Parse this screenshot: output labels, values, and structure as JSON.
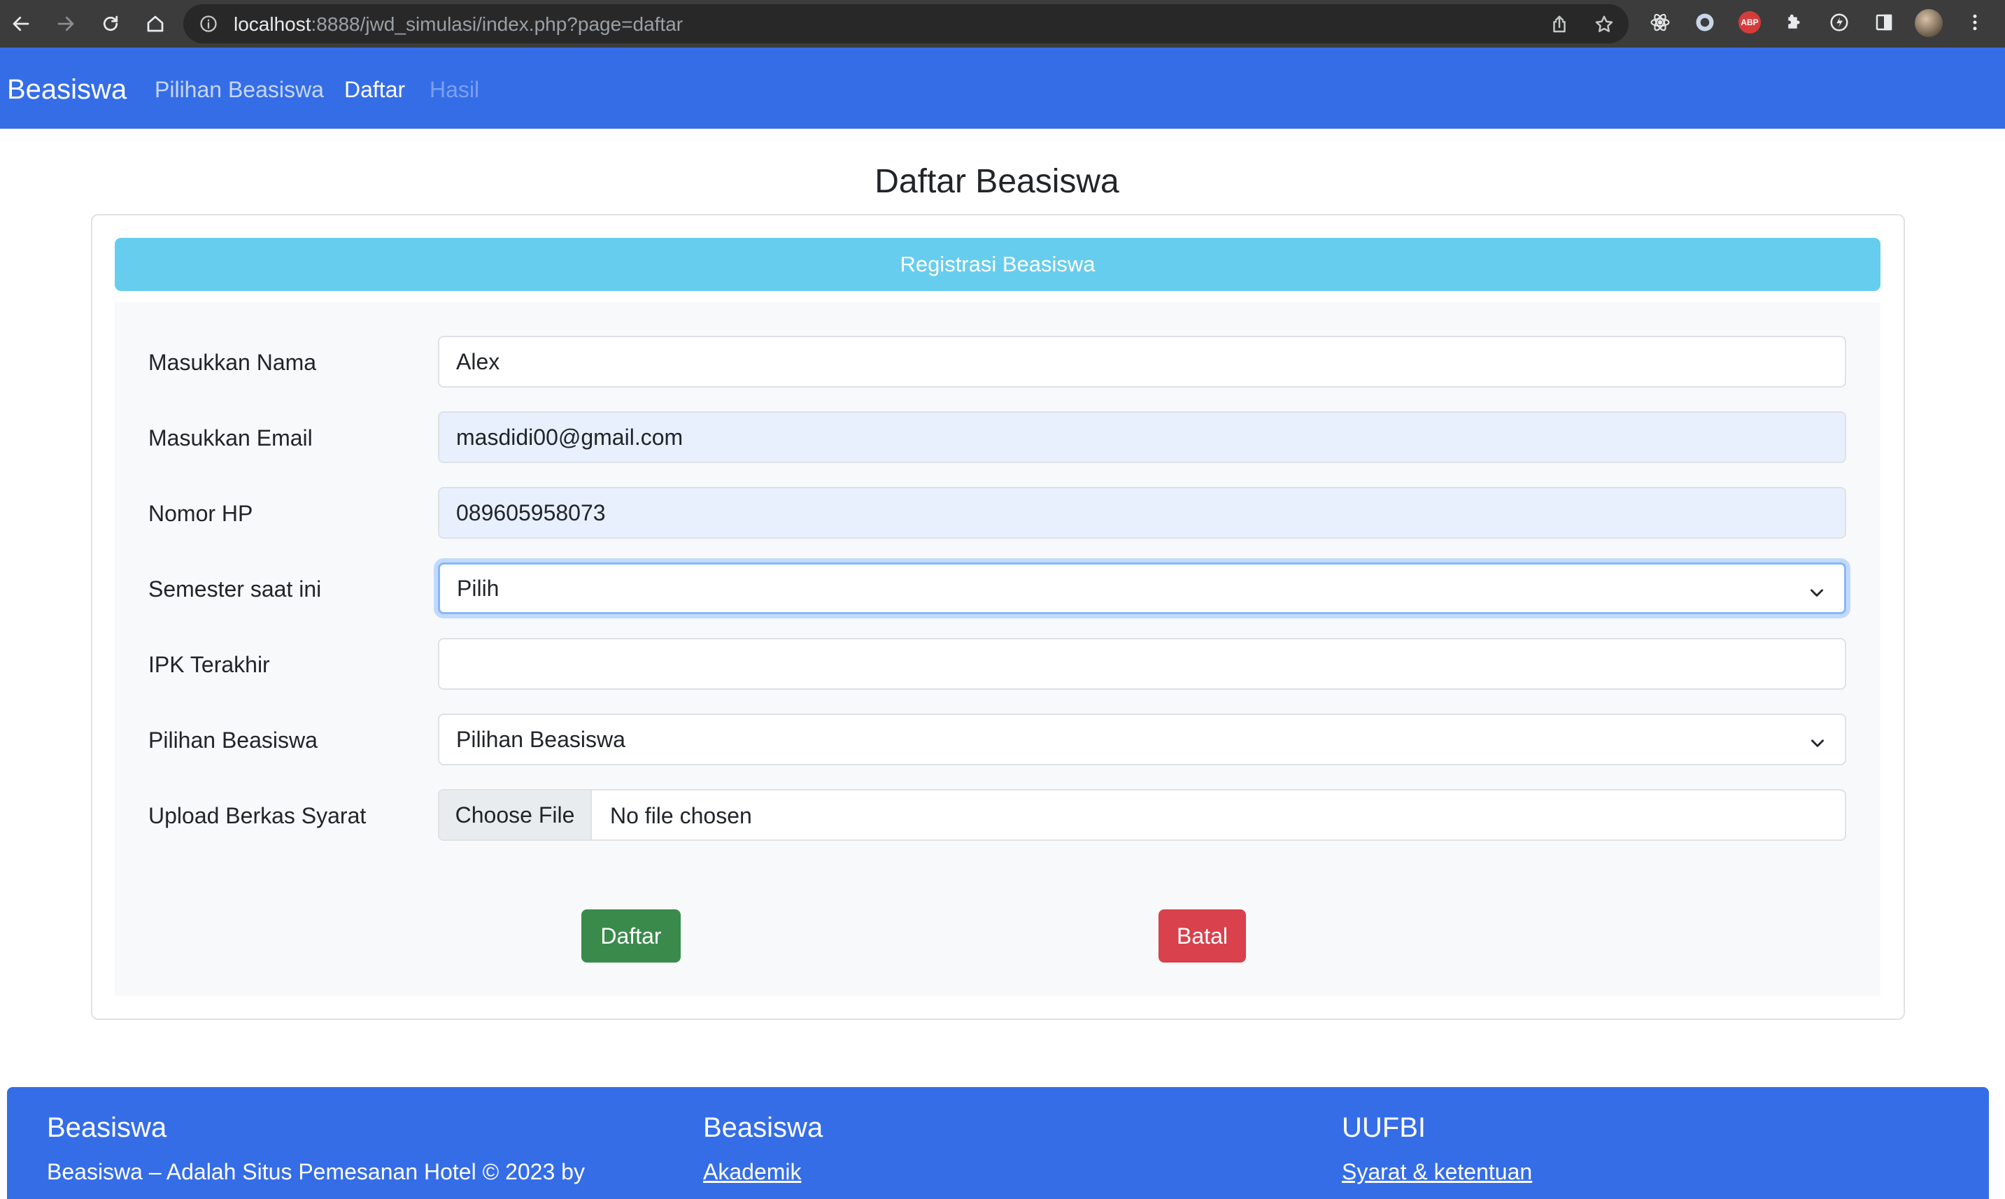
{
  "browser": {
    "url_host": "localhost",
    "url_rest": ":8888/jwd_simulasi/index.php?page=daftar"
  },
  "navbar": {
    "brand": "Beasiswa",
    "links": [
      {
        "label": "Pilihan Beasiswa",
        "state": "normal"
      },
      {
        "label": "Daftar",
        "state": "active"
      },
      {
        "label": "Hasil",
        "state": "disabled"
      }
    ]
  },
  "page": {
    "title": "Daftar Beasiswa"
  },
  "form": {
    "header": "Registrasi Beasiswa",
    "fields": [
      {
        "label": "Masukkan Nama",
        "value": "Alex"
      },
      {
        "label": "Masukkan Email",
        "value": "masdidi00@gmail.com"
      },
      {
        "label": "Nomor HP",
        "value": "089605958073"
      },
      {
        "label": "Semester saat ini",
        "value": "Pilih"
      },
      {
        "label": "IPK Terakhir",
        "value": ""
      },
      {
        "label": "Pilihan Beasiswa",
        "value": "Pilihan Beasiswa"
      },
      {
        "label": "Upload Berkas Syarat",
        "button": "Choose File",
        "value": "No file chosen"
      }
    ],
    "submit_label": "Daftar",
    "cancel_label": "Batal"
  },
  "footer": {
    "col1": {
      "title": "Beasiswa",
      "text": "Beasiswa – Adalah Situs Pemesanan Hotel © 2023 by"
    },
    "col2": {
      "title": "Beasiswa",
      "link": "Akademik"
    },
    "col3": {
      "title": "UUFBI",
      "link": "Syarat & ketentuan"
    }
  },
  "colors": {
    "primary": "#356de7",
    "info": "#67cdee",
    "success": "#3a8a4c",
    "danger": "#d9414c"
  },
  "icons": [
    "back-icon",
    "forward-icon",
    "reload-icon",
    "home-icon",
    "info-icon",
    "share-icon",
    "star-icon",
    "react-devtools-icon",
    "extension-ring-icon",
    "adblock-icon",
    "puzzle-icon",
    "extension-bolt-icon",
    "side-panel-icon",
    "profile-avatar",
    "menu-icon",
    "chevron-down-icon"
  ]
}
